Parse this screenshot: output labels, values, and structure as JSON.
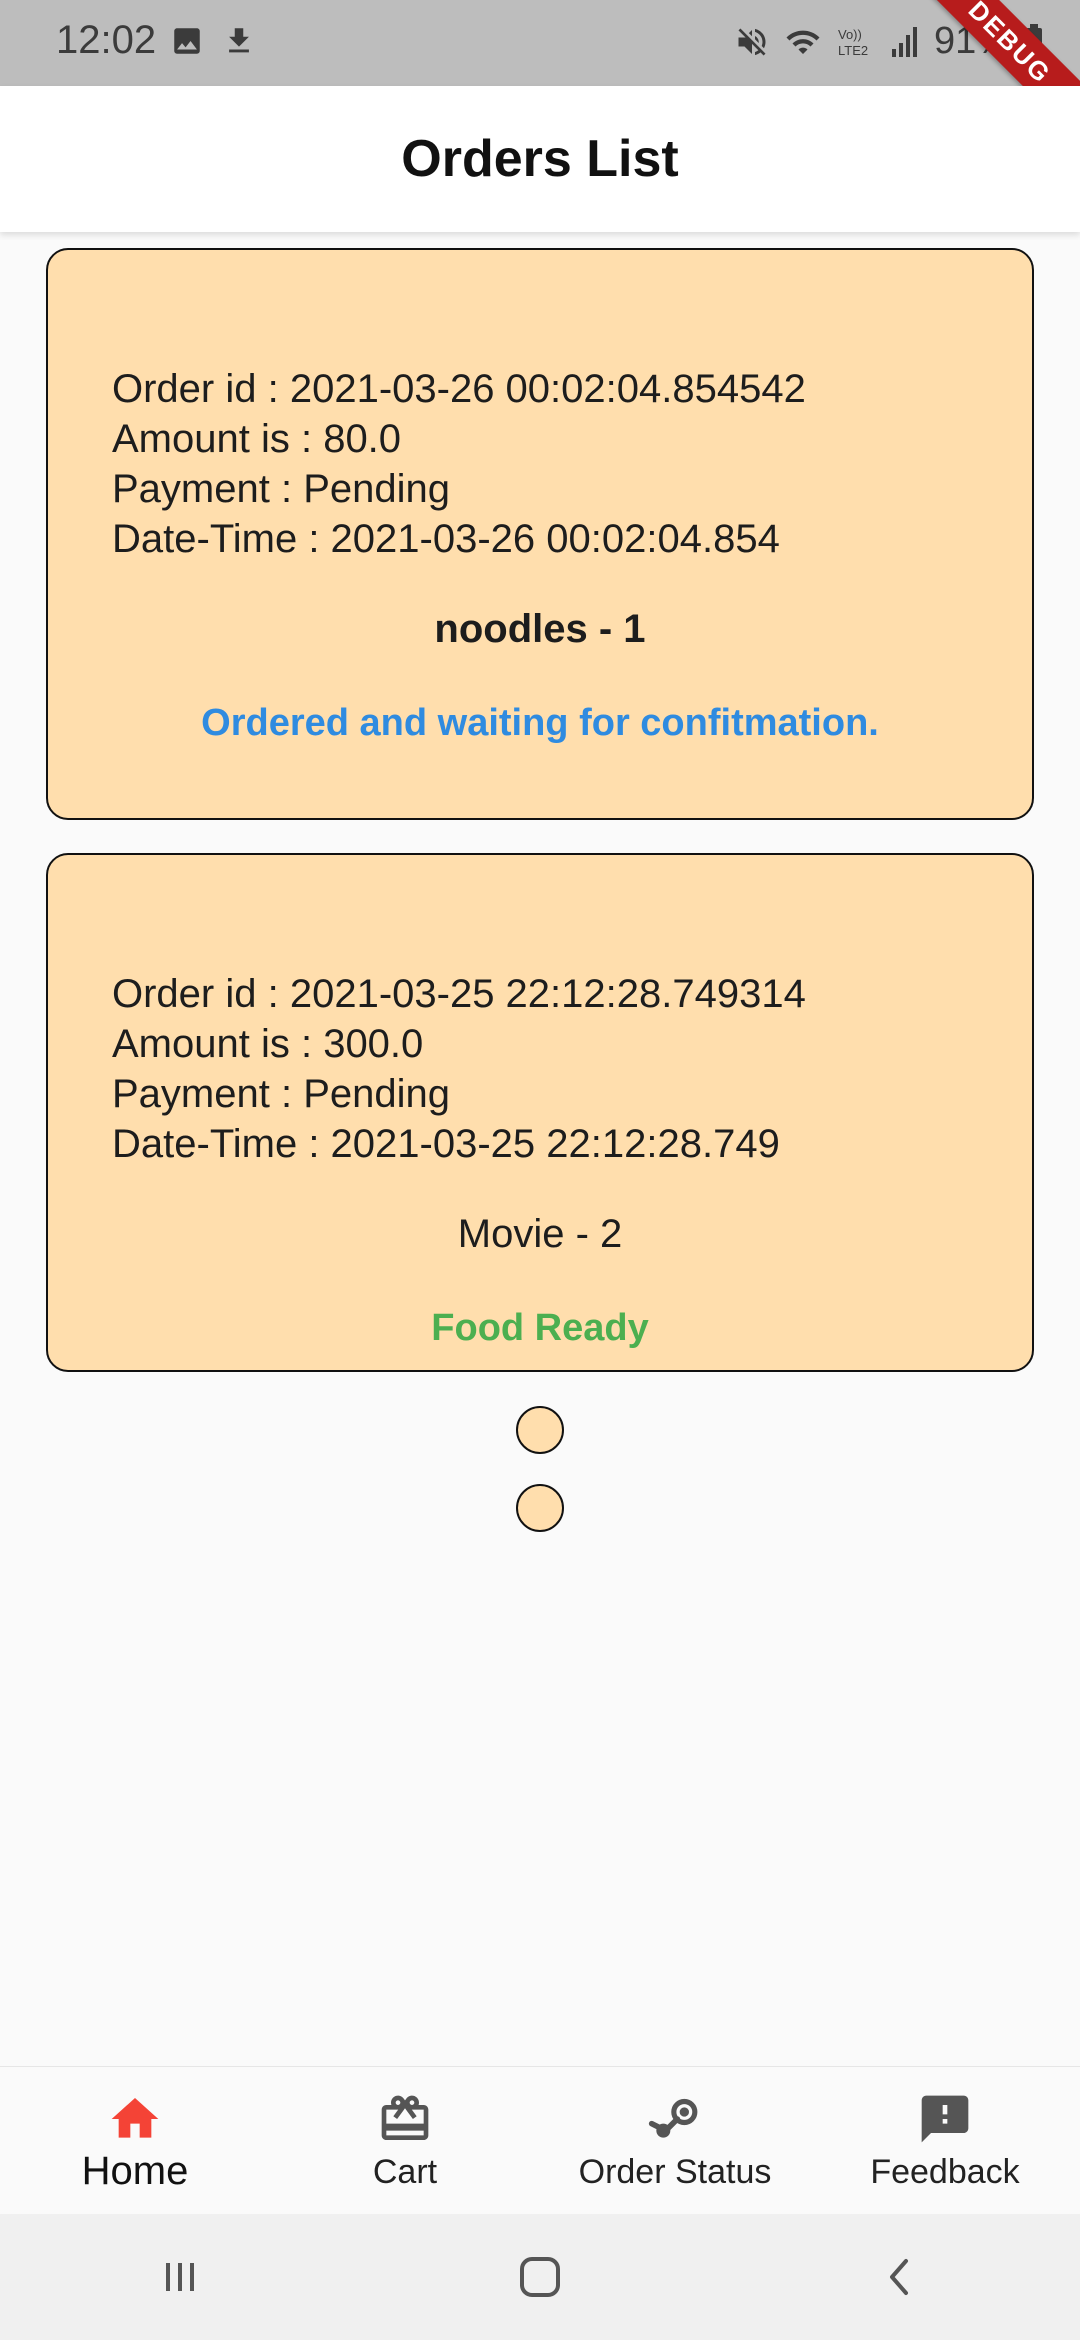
{
  "status_bar": {
    "time": "12:02",
    "battery": "91%",
    "left_icons": [
      "image-icon",
      "download-icon"
    ],
    "right_icons": [
      "mute-icon",
      "wifi-icon",
      "volte-icon",
      "signal-icon",
      "battery-icon"
    ],
    "debug_label": "DEBUG"
  },
  "app_bar": {
    "title": "Orders List"
  },
  "orders": [
    {
      "order_id": "Order id : 2021-03-26 00:02:04.854542",
      "amount": "Amount is : 80.0",
      "payment": "Payment : Pending",
      "datetime": "Date-Time : 2021-03-26 00:02:04.854",
      "item": "noodles - 1",
      "status": "Ordered and waiting for confitmation.",
      "status_color": "#2f8be0"
    },
    {
      "order_id": "Order id : 2021-03-25 22:12:28.749314",
      "amount": "Amount is : 300.0",
      "payment": "Payment : Pending",
      "datetime": "Date-Time : 2021-03-25 22:12:28.749",
      "item": "Movie - 2",
      "status": "Food Ready",
      "status_color": "#4caf50"
    }
  ],
  "bottom_nav": {
    "items": [
      {
        "label": "Home",
        "icon": "home-icon",
        "active": true
      },
      {
        "label": "Cart",
        "icon": "cart-icon",
        "active": false
      },
      {
        "label": "Order Status",
        "icon": "order-status-icon",
        "active": false
      },
      {
        "label": "Feedback",
        "icon": "feedback-icon",
        "active": false
      }
    ],
    "active_color": "#f44336"
  },
  "system_nav": {
    "buttons": [
      "recents-icon",
      "home-circle-icon",
      "back-icon"
    ]
  },
  "colors": {
    "card_bg": "#ffdead",
    "status_bar_bg": "#bdbdbd",
    "debug_ribbon": "#b71c1c"
  }
}
